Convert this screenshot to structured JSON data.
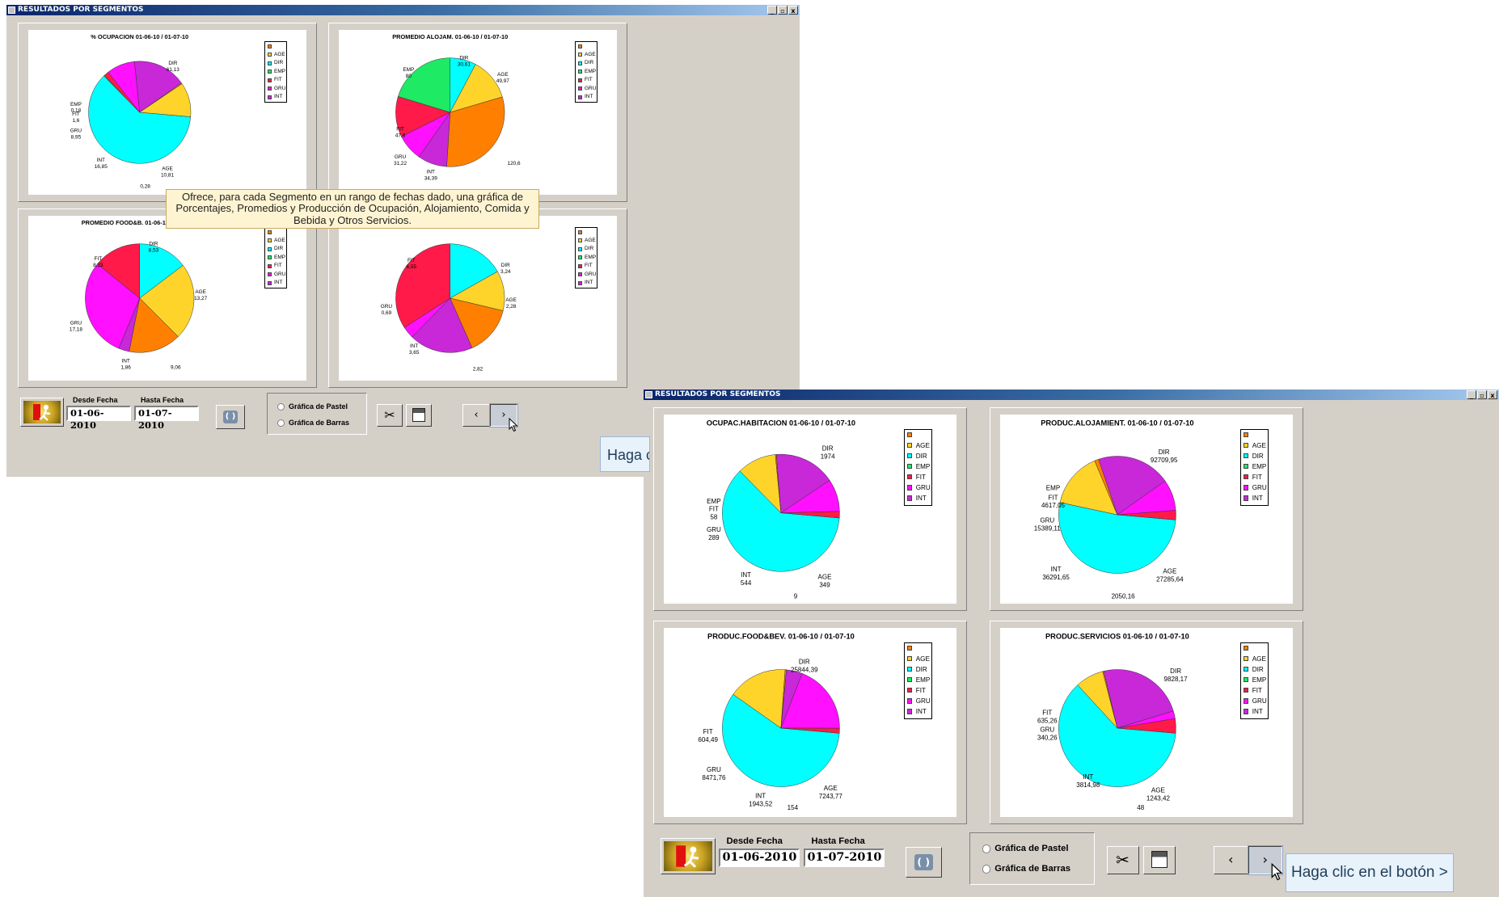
{
  "windows": [
    {
      "title": "RESULTADOS POR SEGMENTOS",
      "controls": [
        "_",
        "▫",
        "x"
      ],
      "legend_items": [
        "",
        "AGE",
        "DIR",
        "EMP",
        "FIT",
        "GRU",
        "INT"
      ],
      "toolbar": {
        "from_label": "Desde Fecha",
        "to_label": "Hasta Fecha",
        "from_value": "01-06-2010",
        "to_value": "01-07-2010",
        "refresh_icon": "refresh-icon",
        "radio_pie": "Gráfica de Pastel",
        "radio_bar": "Gráfica de Barras",
        "selected_chart_type": "Gráfica de Pastel",
        "prev_label": "‹",
        "next_label": "›"
      },
      "tooltip": "Ofrece, para cada Segmento en un rango de fechas dado, una gráfica de Porcentajes, Promedios y Producción de Ocupación, Alojamiento, Comida y Bebida y Otros Servicios.",
      "hint": "Haga c",
      "charts": [
        {
          "title": "% OCUPACION  01-06-10 / 01-07-10",
          "labels": [
            {
              "name": "DIR",
              "value": "61,13"
            },
            {
              "name": "EMP",
              "value": "0,18"
            },
            {
              "name": "FIT",
              "value": "1,6"
            },
            {
              "name": "GRU",
              "value": "8,95"
            },
            {
              "name": "INT",
              "value": "16,85"
            },
            {
              "name": "",
              "value": "0,28"
            },
            {
              "name": "AGE",
              "value": "10,81"
            }
          ]
        },
        {
          "title": "PROMEDIO ALOJAM.  01-06-10 / 01-07-10",
          "labels": [
            {
              "name": "DIR",
              "value": "30,61"
            },
            {
              "name": "AGE",
              "value": "49,97"
            },
            {
              "name": "EMP",
              "value": "80"
            },
            {
              "name": "FIT",
              "value": "47,6"
            },
            {
              "name": "GRU",
              "value": "31,22"
            },
            {
              "name": "INT",
              "value": "34,39"
            },
            {
              "name": "",
              "value": "120,6"
            }
          ]
        },
        {
          "title": "PROMEDIO FOOD&B.  01-06-10 / 01-07-10",
          "labels": [
            {
              "name": "DIR",
              "value": "8,53"
            },
            {
              "name": "FIT",
              "value": "8,23"
            },
            {
              "name": "AGE",
              "value": "13,27"
            },
            {
              "name": "GRU",
              "value": "17,18"
            },
            {
              "name": "INT",
              "value": "1,86"
            },
            {
              "name": "",
              "value": "9,06"
            }
          ]
        },
        {
          "title": "PROMEDIO O.SERV.  01-06-10 / 01-07-10",
          "labels": [
            {
              "name": "FIT",
              "value": "6,55"
            },
            {
              "name": "DIR",
              "value": "3,24"
            },
            {
              "name": "AGE",
              "value": "2,28"
            },
            {
              "name": "GRU",
              "value": "0,69"
            },
            {
              "name": "INT",
              "value": "3,65"
            },
            {
              "name": "",
              "value": "2,82"
            }
          ]
        }
      ]
    },
    {
      "title": "RESULTADOS POR SEGMENTOS",
      "controls": [
        "_",
        "▫",
        "x"
      ],
      "legend_items": [
        "",
        "AGE",
        "DIR",
        "EMP",
        "FIT",
        "GRU",
        "INT"
      ],
      "toolbar": {
        "from_label": "Desde Fecha",
        "to_label": "Hasta Fecha",
        "from_value": "01-06-2010",
        "to_value": "01-07-2010",
        "refresh_icon": "refresh-icon",
        "radio_pie": "Gráfica de Pastel",
        "radio_bar": "Gráfica de Barras",
        "selected_chart_type": "Gráfica de Pastel",
        "prev_label": "‹",
        "next_label": "›"
      },
      "hint": "Haga clic en el botón >",
      "charts": [
        {
          "title": "OCUPAC.HABITACION  01-06-10 / 01-07-10",
          "labels": [
            {
              "name": "DIR",
              "value": "1974"
            },
            {
              "name": "EMP",
              "value": ""
            },
            {
              "name": "FIT",
              "value": "58"
            },
            {
              "name": "GRU",
              "value": "289"
            },
            {
              "name": "INT",
              "value": "544"
            },
            {
              "name": "",
              "value": "9"
            },
            {
              "name": "AGE",
              "value": "349"
            }
          ]
        },
        {
          "title": "PRODUC.ALOJAMIENT.  01-06-10 / 01-07-10",
          "labels": [
            {
              "name": "DIR",
              "value": "92709,95"
            },
            {
              "name": "EMP",
              "value": ""
            },
            {
              "name": "FIT",
              "value": "4617,05"
            },
            {
              "name": "GRU",
              "value": "15389,11"
            },
            {
              "name": "INT",
              "value": "36291,65"
            },
            {
              "name": "AGE",
              "value": "27285,64"
            },
            {
              "name": "",
              "value": "2050,16"
            }
          ]
        },
        {
          "title": "PRODUC.FOOD&BEV.  01-06-10 / 01-07-10",
          "labels": [
            {
              "name": "DIR",
              "value": "25844,39"
            },
            {
              "name": "FIT",
              "value": "604,49"
            },
            {
              "name": "GRU",
              "value": "8471,76"
            },
            {
              "name": "INT",
              "value": "1943,52"
            },
            {
              "name": "",
              "value": "154"
            },
            {
              "name": "AGE",
              "value": "7243,77"
            }
          ]
        },
        {
          "title": "PRODUC.SERVICIOS  01-06-10 / 01-07-10",
          "labels": [
            {
              "name": "DIR",
              "value": "9828,17"
            },
            {
              "name": "FIT",
              "value": "635,26"
            },
            {
              "name": "GRU",
              "value": "340,26"
            },
            {
              "name": "INT",
              "value": "3814,98"
            },
            {
              "name": "",
              "value": "48"
            },
            {
              "name": "AGE",
              "value": "1243,42"
            }
          ]
        }
      ]
    }
  ],
  "segment_colors": {
    "none": "#ff8000",
    "AGE": "#ffd42a",
    "DIR": "#00ffff",
    "EMP": "#1eea64",
    "FIT": "#ff1a4a",
    "GRU": "#ff10ff",
    "INT": "#c828d8"
  },
  "chart_data": [
    {
      "type": "pie",
      "title": "% OCUPACION  01-06-10 / 01-07-10",
      "categories": [
        "DIR",
        "EMP",
        "FIT",
        "GRU",
        "INT",
        "",
        "AGE"
      ],
      "values": [
        61.13,
        0.18,
        1.6,
        8.95,
        16.85,
        0.28,
        10.81
      ]
    },
    {
      "type": "pie",
      "title": "PROMEDIO ALOJAM.  01-06-10 / 01-07-10",
      "categories": [
        "DIR",
        "AGE",
        "",
        "INT",
        "GRU",
        "FIT",
        "EMP"
      ],
      "values": [
        30.61,
        49.97,
        120.6,
        34.39,
        31.22,
        47.6,
        80
      ]
    },
    {
      "type": "pie",
      "title": "PROMEDIO FOOD&B.  01-06-10 / 01-07-10",
      "categories": [
        "DIR",
        "AGE",
        "",
        "INT",
        "GRU",
        "FIT"
      ],
      "values": [
        8.53,
        13.27,
        9.06,
        1.86,
        17.18,
        8.23
      ]
    },
    {
      "type": "pie",
      "title": "PROMEDIO O.SERV.  01-06-10 / 01-07-10",
      "categories": [
        "DIR",
        "AGE",
        "",
        "INT",
        "GRU",
        "FIT"
      ],
      "values": [
        3.24,
        2.28,
        2.82,
        3.65,
        0.69,
        6.55
      ]
    },
    {
      "type": "pie",
      "title": "OCUPAC.HABITACION  01-06-10 / 01-07-10",
      "categories": [
        "DIR",
        "AGE",
        "",
        "INT",
        "GRU",
        "FIT"
      ],
      "values": [
        1974,
        349,
        9,
        544,
        289,
        58
      ]
    },
    {
      "type": "pie",
      "title": "PRODUC.ALOJAMIENT.  01-06-10 / 01-07-10",
      "categories": [
        "DIR",
        "AGE",
        "",
        "INT",
        "GRU",
        "FIT"
      ],
      "values": [
        92709.95,
        27285.64,
        2050.16,
        36291.65,
        15389.11,
        4617.05
      ]
    },
    {
      "type": "pie",
      "title": "PRODUC.FOOD&BEV.  01-06-10 / 01-07-10",
      "categories": [
        "DIR",
        "AGE",
        "",
        "INT",
        "GRU",
        "FIT"
      ],
      "values": [
        25844.39,
        7243.77,
        154,
        1943.52,
        8471.76,
        604.49
      ]
    },
    {
      "type": "pie",
      "title": "PRODUC.SERVICIOS  01-06-10 / 01-07-10",
      "categories": [
        "DIR",
        "AGE",
        "",
        "INT",
        "GRU",
        "FIT"
      ],
      "values": [
        9828.17,
        1243.42,
        48,
        3814.98,
        340.26,
        635.26
      ]
    }
  ]
}
